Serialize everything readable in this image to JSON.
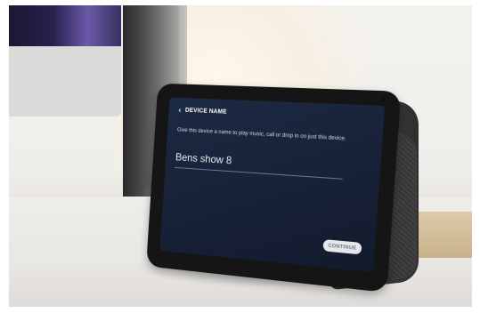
{
  "screen": {
    "title": "DEVICE NAME",
    "description": "Give this device a name to play music, call or drop in on just this device.",
    "name_value": "Bens show 8",
    "continue_label": "CONTINUE"
  },
  "icons": {
    "back": "chevron-left-icon"
  },
  "colors": {
    "screen_bg": "#1a253d",
    "button_bg": "#e6e8ec"
  }
}
